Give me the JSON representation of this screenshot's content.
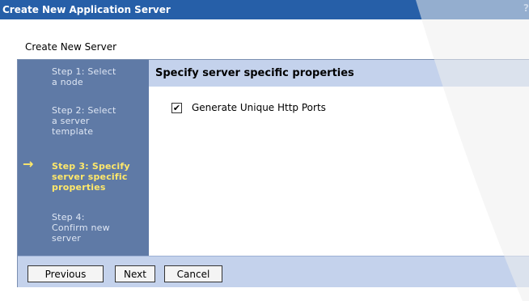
{
  "window": {
    "title": "Create New Application Server",
    "edge_glyph": "?"
  },
  "page": {
    "subtitle": "Create New Server"
  },
  "steps": [
    {
      "label": "Step 1: Select a node",
      "lines": [
        "Step 1: Select",
        "a node"
      ],
      "current": false
    },
    {
      "label": "Step 2: Select a server template",
      "lines": [
        "Step 2: Select",
        "a server",
        "template"
      ],
      "current": false
    },
    {
      "label": "Step 3: Specify server specific properties",
      "lines": [
        "Step 3: Specify",
        "server specific",
        "properties"
      ],
      "current": true
    },
    {
      "label": "Step 4: Confirm new server",
      "lines": [
        "Step 4:",
        "Confirm new",
        "server"
      ],
      "current": false
    }
  ],
  "current_step_icon": "right-arrow-icon",
  "current_step_glyph": "→",
  "panel": {
    "title": "Specify server specific properties",
    "options": [
      {
        "label": "Generate Unique Http Ports",
        "checked": true,
        "check_glyph": "✔"
      }
    ]
  },
  "buttons": {
    "previous": "Previous",
    "next": "Next",
    "cancel": "Cancel"
  },
  "colors": {
    "titlebar": "#265fa8",
    "step_panel": "#5f7aa6",
    "step_text": "#dfe7f4",
    "current_step_text": "#ffe86a",
    "header_bg": "#c4d2ec"
  }
}
